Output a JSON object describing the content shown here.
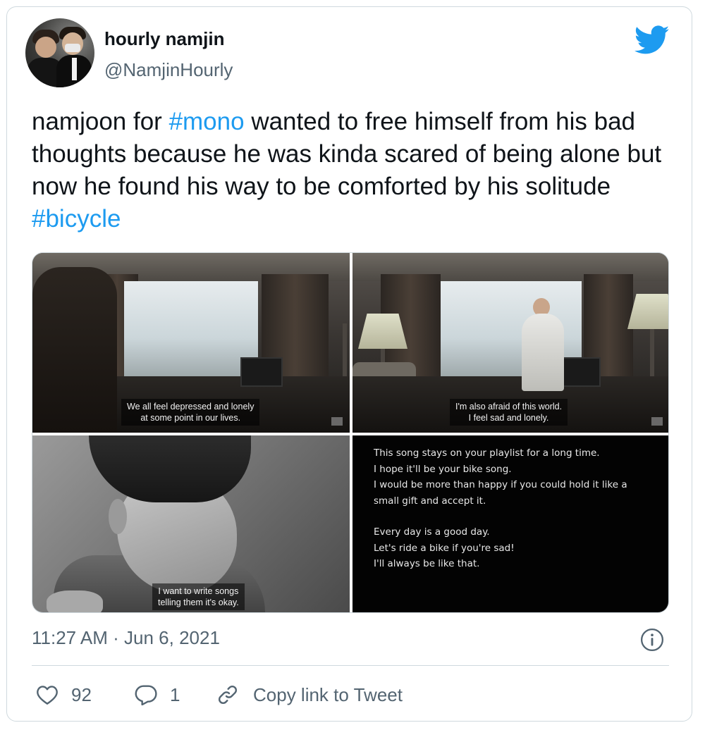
{
  "author": {
    "display_name": "hourly namjin",
    "handle": "@NamjinHourly"
  },
  "tweet": {
    "text_before": "namjoon for ",
    "hashtag_1": "#mono",
    "text_middle": " wanted to free himself from his bad thoughts because he was kinda scared of being alone but now he found his way to be comforted by his solitude ",
    "hashtag_2": "#bicycle"
  },
  "media": {
    "image_1": {
      "subtitle_line_1": "We all feel depressed and lonely",
      "subtitle_line_2": "at some point in our lives."
    },
    "image_2": {
      "subtitle_line_1": "I'm also afraid of this world.",
      "subtitle_line_2": "I feel sad and lonely."
    },
    "image_3": {
      "subtitle_line_1": "I want to write songs",
      "subtitle_line_2": "telling them it's okay."
    },
    "image_4": {
      "lines": [
        "This song stays on your playlist for a long time.",
        "I hope it'll be your bike song.",
        "I would be more than happy if you could hold it like a",
        "small gift and accept it.",
        "Every day is a good day.",
        "Let's ride a bike if you're sad!",
        "I'll always be like that."
      ]
    }
  },
  "meta": {
    "timestamp": "11:27 AM · Jun 6, 2021"
  },
  "actions": {
    "like_count": "92",
    "reply_count": "1",
    "copy_link_label": "Copy link to Tweet"
  },
  "colors": {
    "accent": "#1d9bf0",
    "secondary_text": "#536471",
    "border": "#cfd9de"
  },
  "icons": [
    "twitter-bird-icon",
    "info-icon",
    "heart-icon",
    "reply-bubble-icon",
    "link-icon"
  ]
}
